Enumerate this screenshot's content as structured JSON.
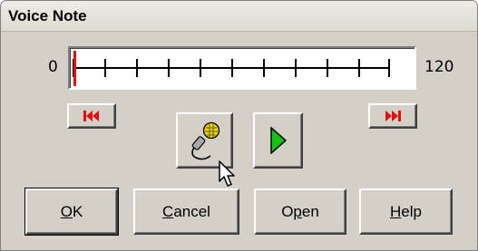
{
  "window": {
    "title": "Voice Note"
  },
  "timeline": {
    "min_label": "0",
    "max_label": "120",
    "position": 0
  },
  "controls": {
    "rewind_icon": "skip-to-start-icon",
    "forward_icon": "skip-to-end-icon",
    "record_icon": "microphone-icon",
    "play_icon": "play-icon"
  },
  "buttons": {
    "ok": {
      "mnemonic": "O",
      "rest": "K"
    },
    "cancel": {
      "mnemonic": "C",
      "rest": "ancel"
    },
    "open": {
      "before": "O",
      "mnemonic": "p",
      "rest": "en"
    },
    "help": {
      "mnemonic": "H",
      "rest": "elp"
    }
  },
  "colors": {
    "accent_red": "#e01010",
    "play_green": "#14c414",
    "face": "#d4d0c8"
  }
}
